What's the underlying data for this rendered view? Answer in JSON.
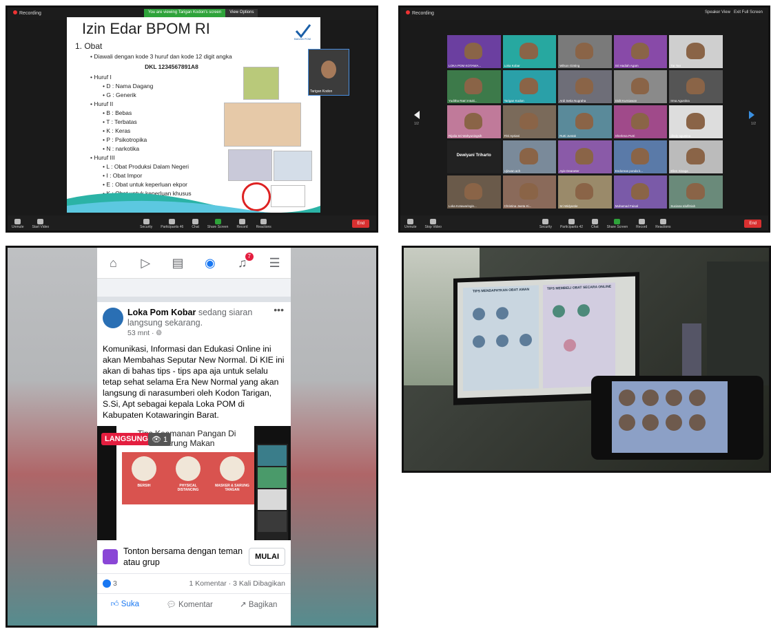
{
  "zoom_share": {
    "recording": "Recording",
    "banner_viewing": "You are viewing Tarigan Kodon's screen",
    "banner_options": "View Options",
    "slide": {
      "title": "Izin Edar BPOM RI",
      "logo_text": "BADAN POM",
      "section": "1.  Obat",
      "intro": "Diawali dengan kode 3 huruf dan kode 12 digit angka",
      "code": "DKL 1234567891A8",
      "groups": [
        {
          "label": "Huruf I",
          "items": [
            "D : Nama Dagang",
            "G : Generik"
          ]
        },
        {
          "label": "Huruf II",
          "items": [
            "B : Bebas",
            "T : Terbatas",
            "K : Keras",
            "P : Psikotropika",
            "N : narkotika"
          ]
        },
        {
          "label": "Huruf III",
          "items": [
            "L : Obat Produksi Dalam Negeri",
            "I : Obat Impor",
            "E : Obat untuk keperluan ekpor",
            "K : Obat untuk keperluan khusus"
          ]
        }
      ]
    },
    "camera_name": "Tarigan Kodon",
    "toolbar": [
      "Unmute",
      "Start Video",
      "Security",
      "Participants",
      "Chat",
      "Share Screen",
      "Record",
      "Reactions"
    ],
    "participant_count": "46",
    "end": "End"
  },
  "zoom_gallery": {
    "recording": "Recording",
    "speaker_view": "Speaker View",
    "exit_full": "Exit Full Screen",
    "page_left": "1/2",
    "page_right": "1/2",
    "participants": [
      "LOKA POM KOTAWA...",
      "Loka Kobar",
      "Wilson Ginting",
      "Sri Hadiah Agam",
      "Tar Tan",
      "Yuditha Ratri Intuiti...",
      "Tarigan Kodon",
      "Ardi Setia Nugraha",
      "Didit Kurniawan",
      "Irma Agustina",
      "Rijalia Sri Wahyuningsih",
      "Fitri Apriani",
      "Rutti Juntak",
      "Sherlena Putri",
      "dindy agustina",
      "Dewiyani Triharto",
      "Ujirwan ach",
      "Ayie Deaneter",
      "Endoreas ponda k...",
      "Ellen Sinaga",
      "Loka Kotawaringin...",
      "Christina Jweta Ki...",
      "Sri Widyastie",
      "Muhamad Faisal",
      "Suciana Idulfitriah"
    ],
    "toolbar": [
      "Unmute",
      "Stop Video",
      "Security",
      "Participants",
      "Chat",
      "Share Screen",
      "Record",
      "Reactions"
    ],
    "participant_count": "42",
    "end": "End"
  },
  "facebook": {
    "notif_count": "7",
    "page_name": "Loka Pom Kobar",
    "live_text": "sedang siaran langsung sekarang.",
    "time": "53 mnt · ",
    "post_text": "Komunikasi, Informasi dan Edukasi Online ini akan Membahas Seputar New Normal. Di KIE ini akan di bahas tips - tips apa aja untuk selalu tetap sehat selama Era New Normal yang akan langsung di narasumberi oleh Kodon Tarigan, S.Si, Apt sebagai kepala Loka POM di Kabupaten Kotawaringin Barat.",
    "video_title": "Tips Keamanan Pangan Di Warung Makan",
    "live_badge": "LANGSUNG",
    "views": "1",
    "video_labels": [
      "BERSIH",
      "PHYSICAL DISTANCING",
      "MASKER & SARUNG TANGAN"
    ],
    "watch_text": "Tonton bersama dengan teman atau grup",
    "mulai": "MULAI",
    "likes": "3",
    "comments_shares": "1 Komentar · 3 Kali Dibagikan",
    "actions": [
      "Suka",
      "Komentar",
      "Bagikan"
    ]
  },
  "photo": {
    "poster_left": "TIPS MENDAPATKAN OBAT AMAN",
    "poster_right": "TIPS MEMBELI OBAT SECARA ONLINE"
  }
}
